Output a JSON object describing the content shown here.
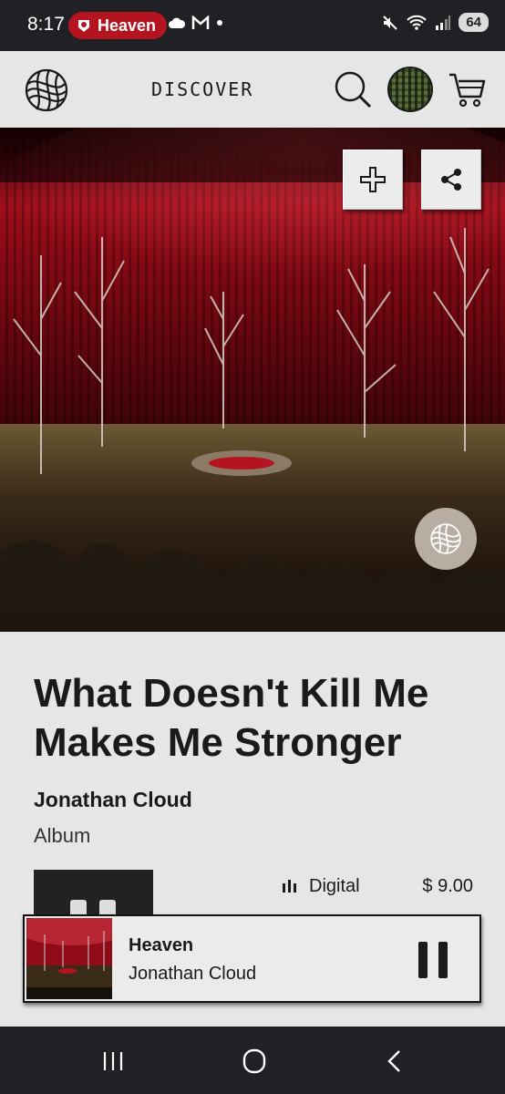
{
  "status_bar": {
    "time": "8:17",
    "chip_label": "Heaven",
    "battery": "64",
    "accent_color": "#b3141f"
  },
  "header": {
    "title": "DISCOVER",
    "icons": [
      "globe-logo-icon",
      "search-icon",
      "avatar",
      "cart-icon"
    ]
  },
  "cover": {
    "action_icons": [
      "plus-icon",
      "share-icon"
    ],
    "badge_icon": "globe-logo-icon"
  },
  "release": {
    "title": "What Doesn't Kill Me Makes Me Stronger",
    "artist": "Jonathan Cloud",
    "type": "Album",
    "formats": [
      {
        "label": "Digital",
        "price": "$ 9.00",
        "icon": "bars-icon"
      }
    ]
  },
  "player": {
    "track": "Heaven",
    "artist": "Jonathan Cloud",
    "state_icon": "pause-icon"
  },
  "nav": {
    "icons": [
      "recents-icon",
      "home-icon",
      "back-icon"
    ]
  }
}
